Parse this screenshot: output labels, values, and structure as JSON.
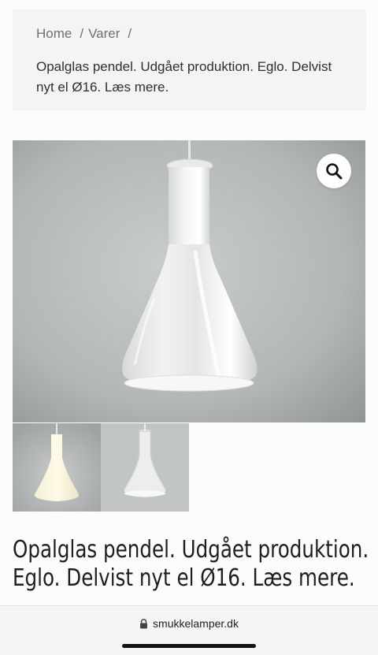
{
  "breadcrumb": {
    "home": "Home",
    "separator": "/",
    "category": "Varer",
    "current_title": "Opalglas pendel. Udgået produktion. Eglo. Delvist nyt el Ø16. Læs mere."
  },
  "product": {
    "title": "Opalglas pendel. Udgået produktion. Eglo. Delvist nyt el Ø16. Læs mere.",
    "main_image_icon": "zoom-magnifier-icon",
    "thumbnails": [
      {
        "name": "thumbnail-lit-lamp"
      },
      {
        "name": "thumbnail-unlit-lamp"
      }
    ]
  },
  "browser": {
    "url": "smukkelamper.dk",
    "lock_icon": "lock-icon"
  },
  "colors": {
    "background": "#fdfcfd",
    "breadcrumb_bg": "#f5f4f5",
    "text": "#1e1e1e",
    "muted_text": "#6f6f6f"
  }
}
